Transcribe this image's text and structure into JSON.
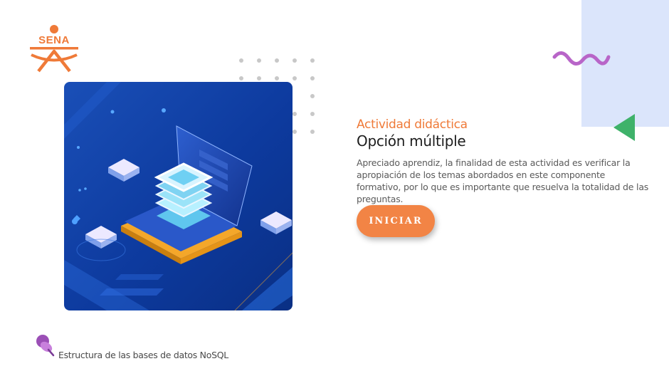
{
  "logo": {
    "text": "SENA",
    "color": "#ef7a38"
  },
  "hero": {
    "image": "server-laptop-illustration"
  },
  "content": {
    "eyebrow": "Actividad didáctica",
    "title": "Opción múltiple",
    "description": "Apreciado aprendiz, la finalidad de esta actividad es verificar la apropiación de los temas abordados en este componente formativo, por lo que es importante que resuelva la totalidad de las preguntas."
  },
  "actions": {
    "start_label": "INICIAR"
  },
  "footer": {
    "icon": "pushpin-icon",
    "text": "Estructura de las bases de datos  NoSQL"
  },
  "colors": {
    "accent": "#ef7a38",
    "button": "#f28445",
    "decor_bg": "#dbe5fb",
    "wave": "#b865c8",
    "triangle": "#3fb26a"
  }
}
